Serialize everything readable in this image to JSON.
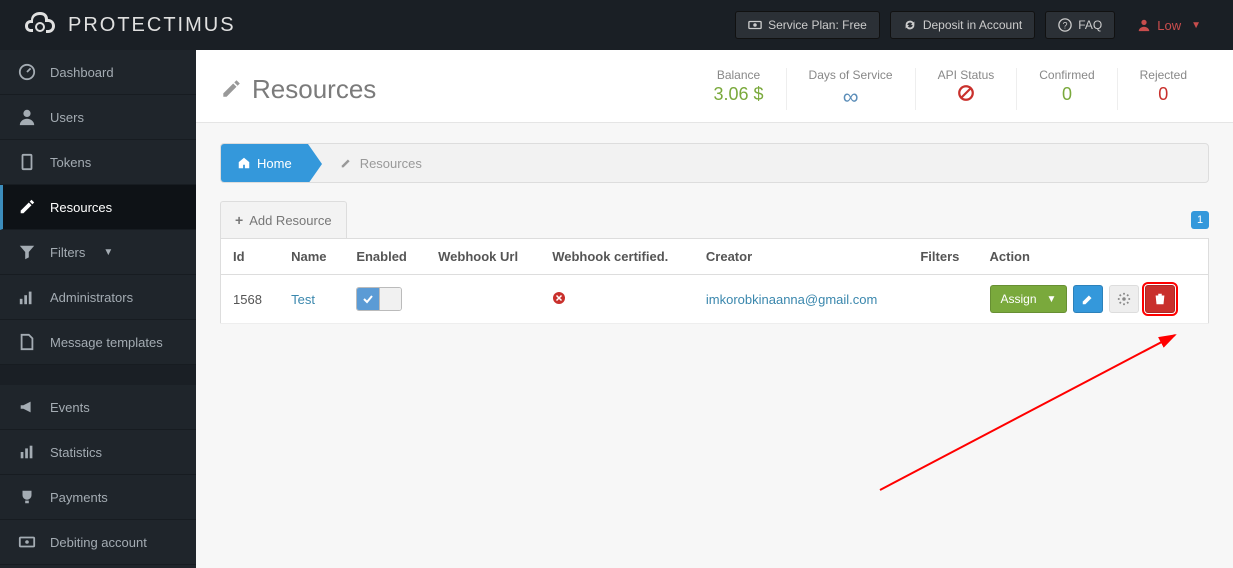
{
  "topbar": {
    "logo_text": "PROTECTIMUS",
    "service_plan": "Service Plan: Free",
    "deposit": "Deposit in Account",
    "faq": "FAQ",
    "user": "Low"
  },
  "sidebar": {
    "items": [
      {
        "label": "Dashboard"
      },
      {
        "label": "Users"
      },
      {
        "label": "Tokens"
      },
      {
        "label": "Resources"
      },
      {
        "label": "Filters"
      },
      {
        "label": "Administrators"
      },
      {
        "label": "Message templates"
      }
    ],
    "bottom": [
      {
        "label": "Events"
      },
      {
        "label": "Statistics"
      },
      {
        "label": "Payments"
      },
      {
        "label": "Debiting account"
      }
    ]
  },
  "page": {
    "title": "Resources",
    "stats": {
      "balance_label": "Balance",
      "balance_value": "3.06 $",
      "days_label": "Days of Service",
      "days_value": "∞",
      "api_label": "API Status",
      "confirmed_label": "Confirmed",
      "confirmed_value": "0",
      "rejected_label": "Rejected",
      "rejected_value": "0"
    }
  },
  "breadcrumb": {
    "home": "Home",
    "current": "Resources"
  },
  "toolbar": {
    "add_label": "Add Resource",
    "page": "1"
  },
  "table": {
    "headers": {
      "id": "Id",
      "name": "Name",
      "enabled": "Enabled",
      "webhook_url": "Webhook Url",
      "webhook_cert": "Webhook certified.",
      "creator": "Creator",
      "filters": "Filters",
      "action": "Action"
    },
    "rows": [
      {
        "id": "1568",
        "name": "Test",
        "creator": "imkorobkinaanna@gmail.com"
      }
    ],
    "assign_label": "Assign"
  }
}
